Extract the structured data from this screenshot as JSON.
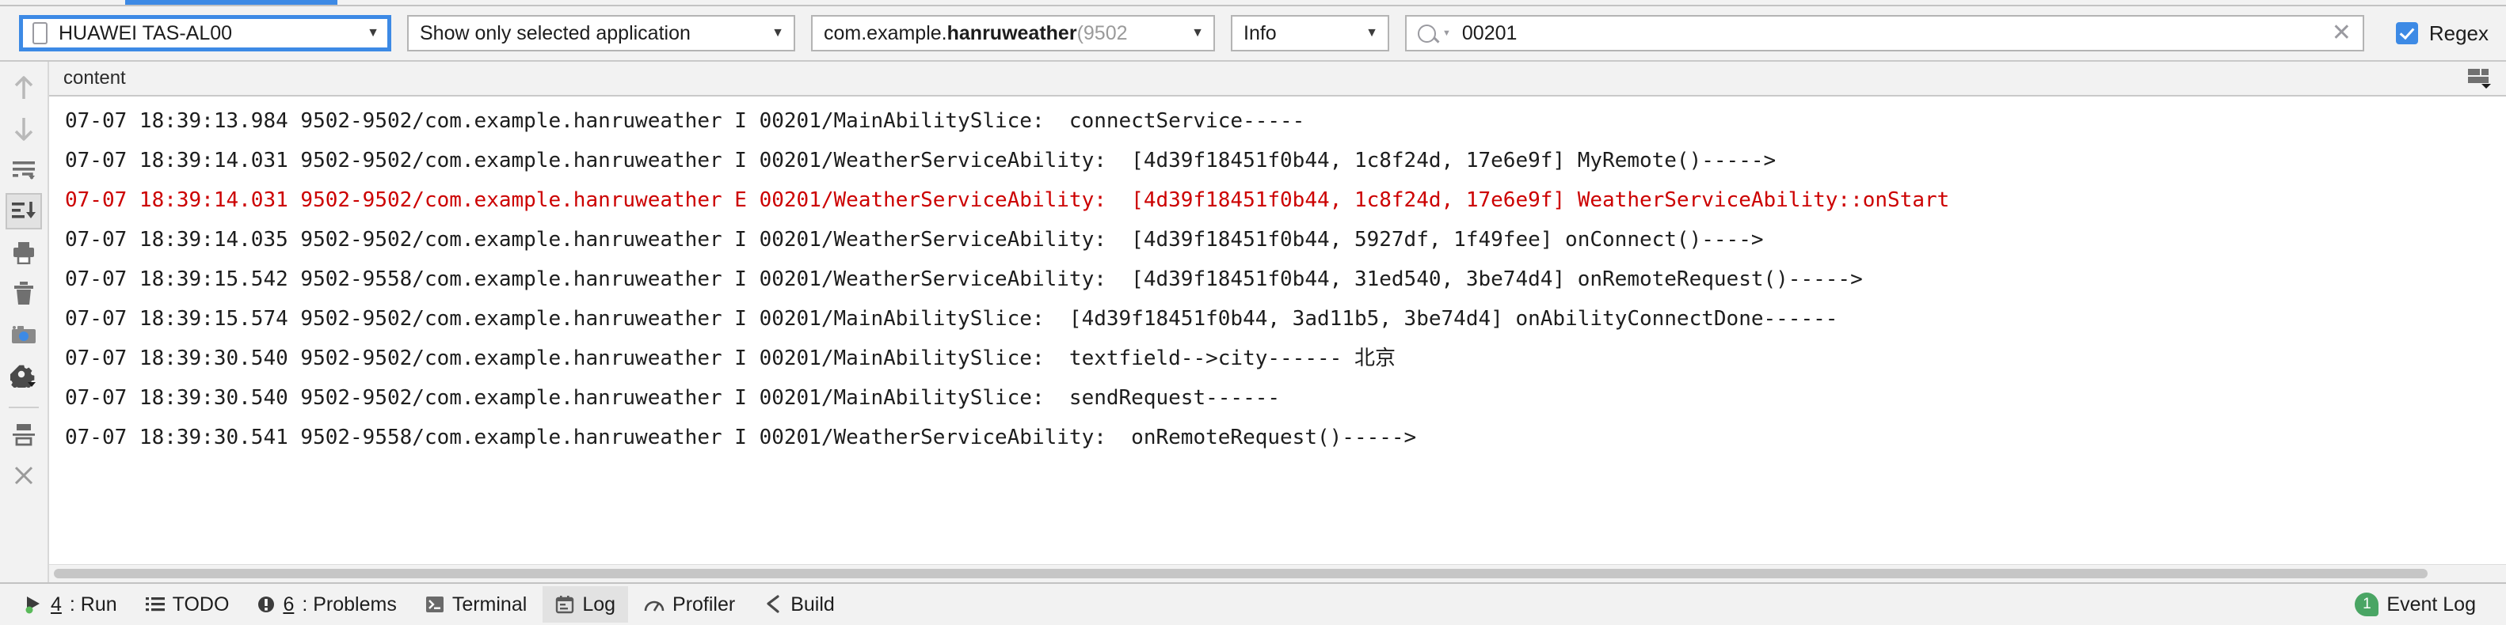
{
  "toolbar": {
    "device": {
      "label": "HUAWEI TAS-AL00",
      "icon": "phone-icon",
      "caret": "▼"
    },
    "filter": {
      "label": "Show only selected application",
      "caret": "▼"
    },
    "process": {
      "package_prefix": "com.example.",
      "package_bold": "hanruweather",
      "pid": " (9502",
      "caret": "▼"
    },
    "level": {
      "label": "Info",
      "caret": "▼"
    },
    "search": {
      "value": "00201",
      "placeholder": "",
      "clear": "✕"
    },
    "regex": {
      "label": "Regex",
      "checked": true
    },
    "accent_color": "#3d8ae5"
  },
  "gutter": {
    "items": [
      {
        "name": "scroll-up-icon",
        "tooltip": "Up"
      },
      {
        "name": "scroll-down-icon",
        "tooltip": "Down"
      },
      {
        "name": "soft-wrap-icon",
        "tooltip": "Soft-Wrap"
      },
      {
        "name": "scroll-to-end-icon",
        "tooltip": "Scroll to the end",
        "active": true
      },
      {
        "name": "print-icon",
        "tooltip": "Print"
      },
      {
        "name": "clear-all-icon",
        "tooltip": "Clear All"
      },
      {
        "name": "screenshot-icon",
        "tooltip": "Screen Capture"
      },
      {
        "name": "settings-gear-icon",
        "tooltip": "Settings"
      },
      {
        "name": "split-pane-icon",
        "tooltip": "Split"
      },
      {
        "name": "close-icon",
        "tooltip": "Close"
      }
    ]
  },
  "log_pane": {
    "column_header": "content",
    "settings_icon": "table-layout-icon",
    "lines": [
      {
        "level": "I",
        "text": "07-07 18:39:13.984 9502-9502/com.example.hanruweather I 00201/MainAbilitySlice:  connectService-----"
      },
      {
        "level": "I",
        "text": "07-07 18:39:14.031 9502-9502/com.example.hanruweather I 00201/WeatherServiceAbility:  [4d39f18451f0b44, 1c8f24d, 17e6e9f] MyRemote()----->"
      },
      {
        "level": "E",
        "text": "07-07 18:39:14.031 9502-9502/com.example.hanruweather E 00201/WeatherServiceAbility:  [4d39f18451f0b44, 1c8f24d, 17e6e9f] WeatherServiceAbility::onStart"
      },
      {
        "level": "I",
        "text": "07-07 18:39:14.035 9502-9502/com.example.hanruweather I 00201/WeatherServiceAbility:  [4d39f18451f0b44, 5927df, 1f49fee] onConnect()---->"
      },
      {
        "level": "I",
        "text": "07-07 18:39:15.542 9502-9558/com.example.hanruweather I 00201/WeatherServiceAbility:  [4d39f18451f0b44, 31ed540, 3be74d4] onRemoteRequest()----->"
      },
      {
        "level": "I",
        "text": "07-07 18:39:15.574 9502-9502/com.example.hanruweather I 00201/MainAbilitySlice:  [4d39f18451f0b44, 3ad11b5, 3be74d4] onAbilityConnectDone------"
      },
      {
        "level": "I",
        "text": "07-07 18:39:30.540 9502-9502/com.example.hanruweather I 00201/MainAbilitySlice:  textfield-->city------ 北京"
      },
      {
        "level": "I",
        "text": "07-07 18:39:30.540 9502-9502/com.example.hanruweather I 00201/MainAbilitySlice:  sendRequest------"
      },
      {
        "level": "I",
        "text": "07-07 18:39:30.541 9502-9558/com.example.hanruweather I 00201/WeatherServiceAbility:  onRemoteRequest()----->"
      }
    ],
    "error_color": "#cc0000"
  },
  "statusbar": {
    "items": [
      {
        "key": "4",
        "label": ": Run",
        "icon": "run-play-icon",
        "active": false
      },
      {
        "key": "",
        "label": "TODO",
        "icon": "todo-list-icon",
        "active": false
      },
      {
        "key": "6",
        "label": ": Problems",
        "icon": "problems-warning-icon",
        "active": false
      },
      {
        "key": "",
        "label": "Terminal",
        "icon": "terminal-icon",
        "active": false
      },
      {
        "key": "",
        "label": "Log",
        "icon": "log-icon",
        "active": true
      },
      {
        "key": "",
        "label": "Profiler",
        "icon": "profiler-icon",
        "active": false
      },
      {
        "key": "",
        "label": "Build",
        "icon": "build-hammer-icon",
        "active": false
      }
    ],
    "event_log": {
      "label": "Event Log",
      "badge": "1",
      "badge_color": "#4aa564"
    }
  }
}
